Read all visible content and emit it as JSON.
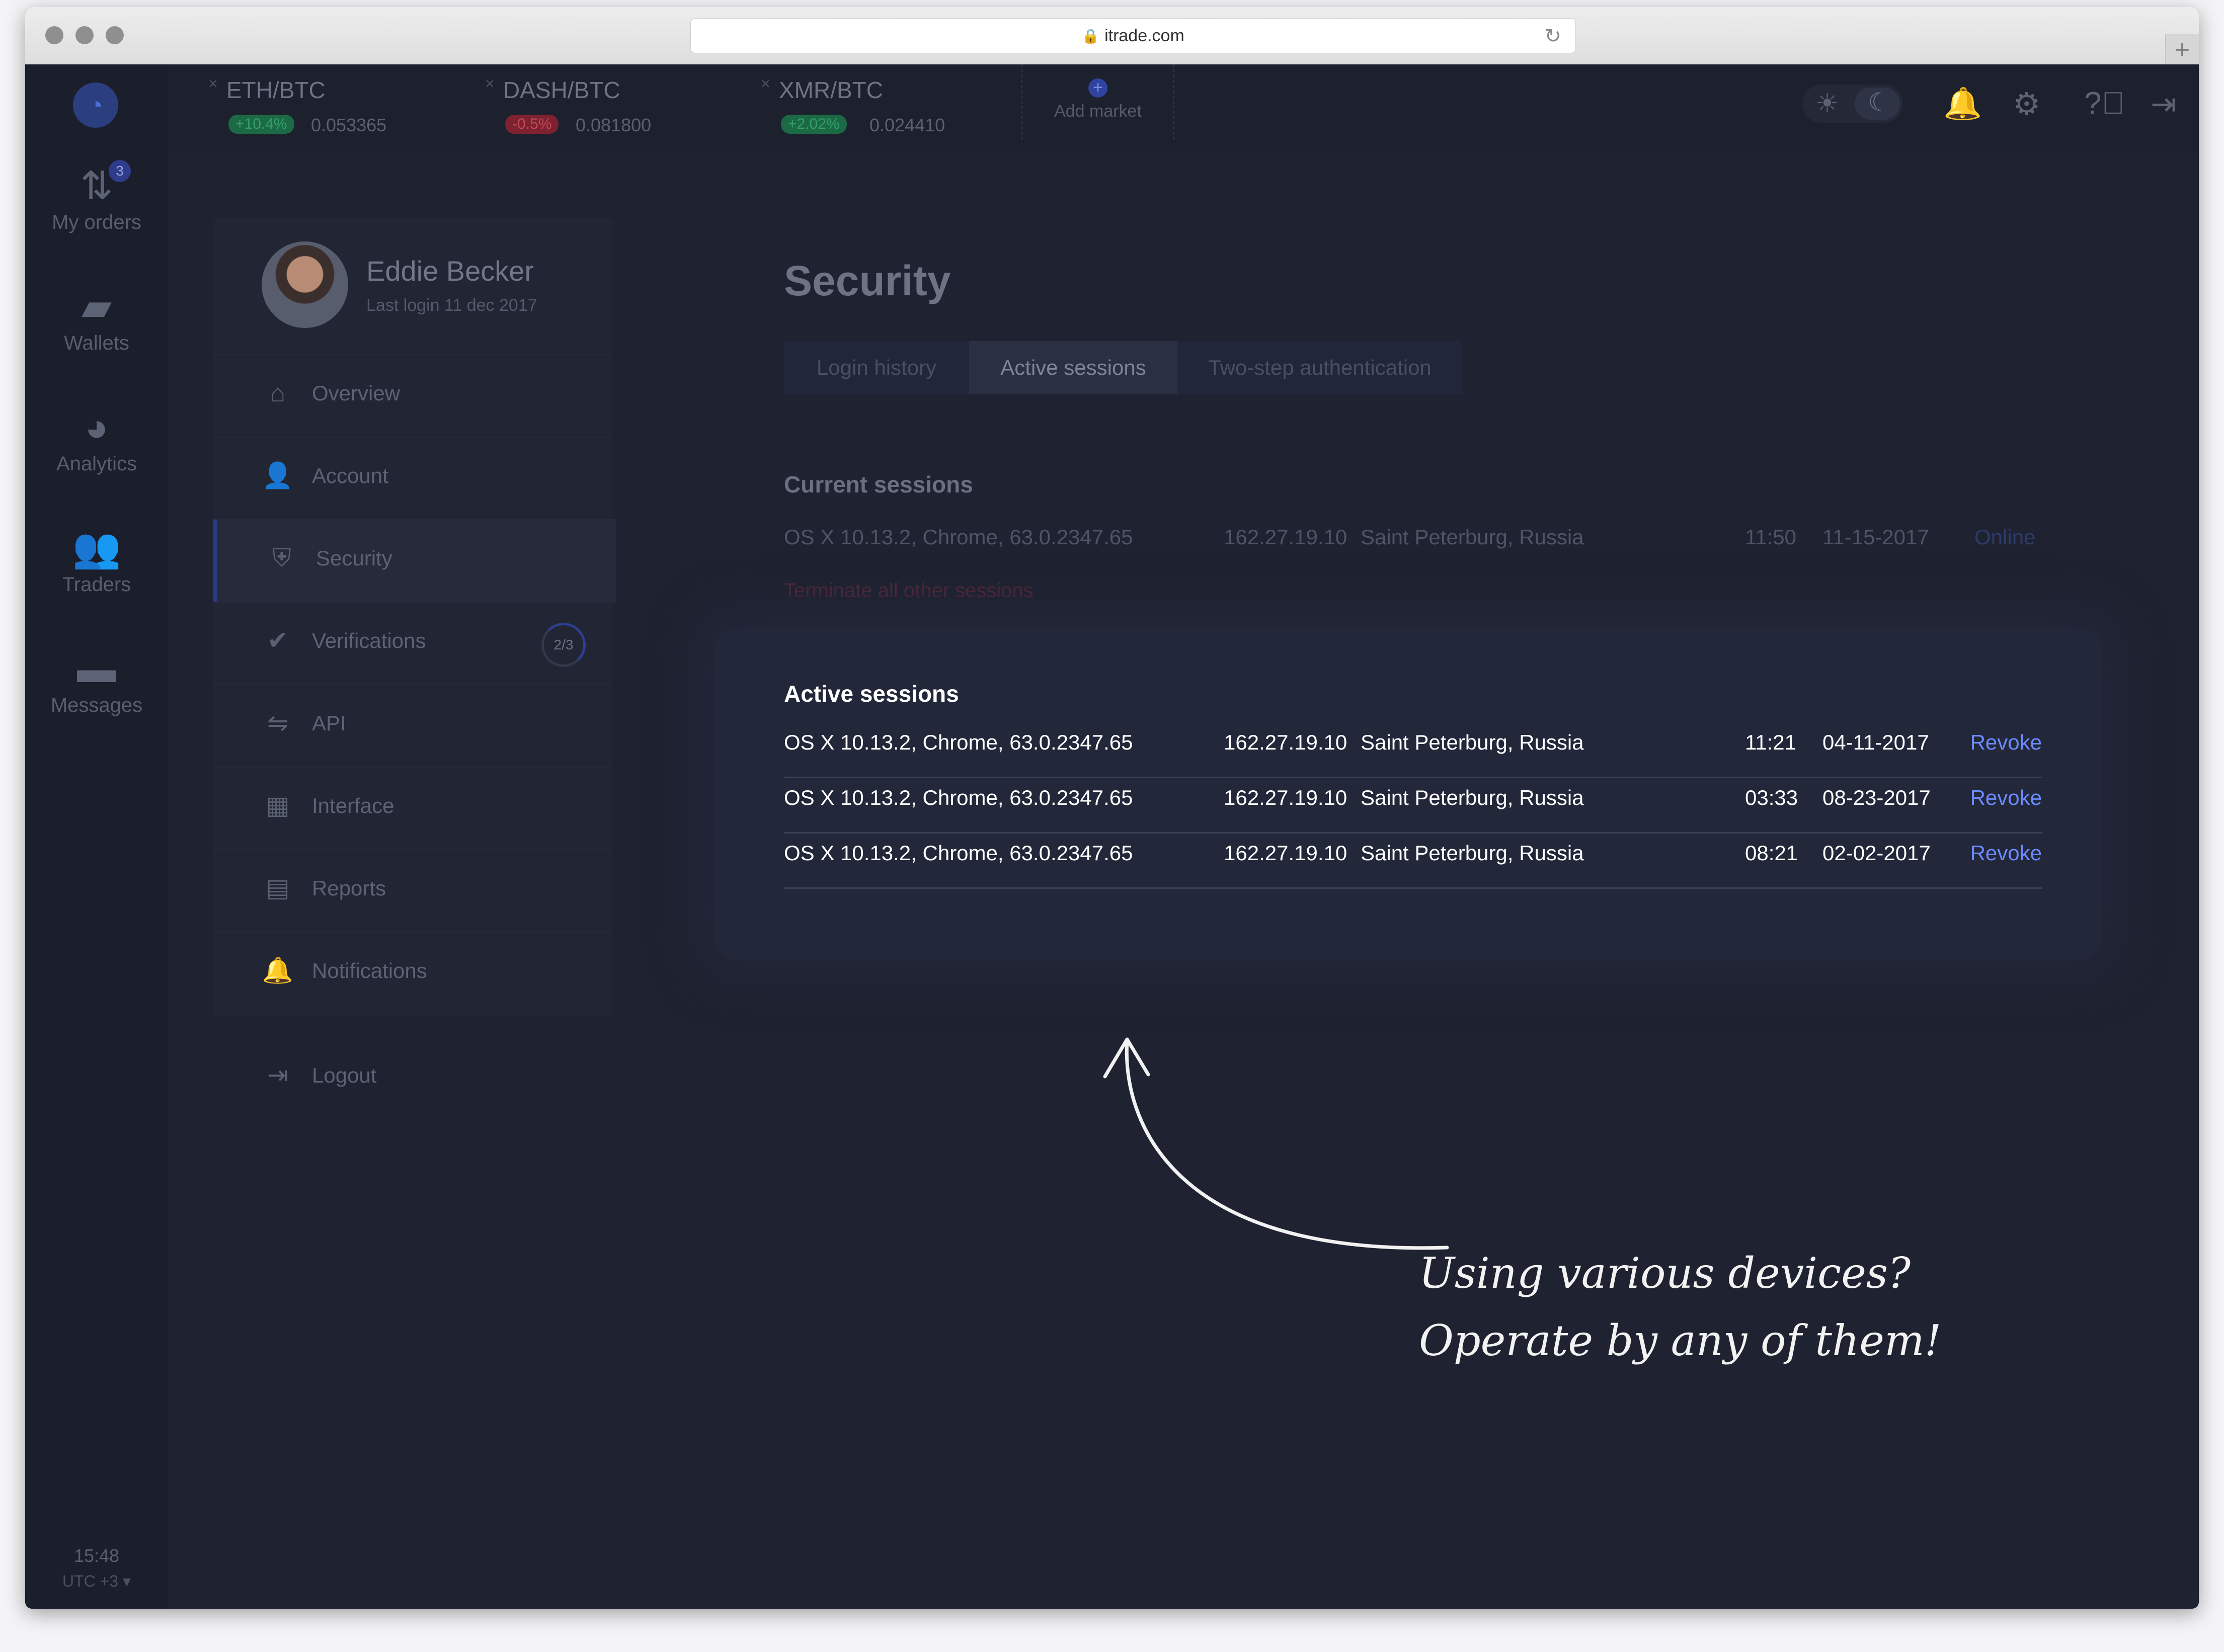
{
  "browser": {
    "url": "itrade.com"
  },
  "rail": {
    "orders_badge": "3",
    "items": [
      {
        "label": "My orders",
        "icon": "arrows-updown-icon"
      },
      {
        "label": "Wallets",
        "icon": "wallet-icon"
      },
      {
        "label": "Analytics",
        "icon": "pie-chart-icon"
      },
      {
        "label": "Traders",
        "icon": "users-icon"
      },
      {
        "label": "Messages",
        "icon": "chat-icon"
      }
    ],
    "clock": "15:48",
    "timezone": "UTC +3 ▾"
  },
  "markets": [
    {
      "pair": "ETH/BTC",
      "change": "+10.4%",
      "price": "0.053365",
      "direction": "up"
    },
    {
      "pair": "DASH/BTC",
      "change": "-0.5%",
      "price": "0.081800",
      "direction": "down"
    },
    {
      "pair": "XMR/BTC",
      "change": "+2.02%",
      "price": "0.024410",
      "direction": "up"
    }
  ],
  "add_market": "Add market",
  "profile": {
    "name": "Eddie Becker",
    "last_login": "Last login 11 dec 2017",
    "menu": [
      {
        "label": "Overview",
        "icon": "home-icon"
      },
      {
        "label": "Account",
        "icon": "person-icon"
      },
      {
        "label": "Security",
        "icon": "shield-icon",
        "active": true
      },
      {
        "label": "Verifications",
        "icon": "check-circle-icon",
        "progress": "2/3"
      },
      {
        "label": "API",
        "icon": "api-icon"
      },
      {
        "label": "Interface",
        "icon": "table-icon"
      },
      {
        "label": "Reports",
        "icon": "document-icon"
      },
      {
        "label": "Notifications",
        "icon": "bell-icon"
      }
    ],
    "logout": "Logout"
  },
  "page": {
    "title": "Security",
    "tabs": [
      {
        "label": "Login history"
      },
      {
        "label": "Active sessions",
        "active": true
      },
      {
        "label": "Two-step authentication"
      }
    ]
  },
  "current_sessions": {
    "title": "Current sessions",
    "row": {
      "device": "OS X 10.13.2, Chrome, 63.0.2347.65",
      "ip": "162.27.19.10",
      "location": "Saint Peterburg, Russia",
      "time": "11:50",
      "date": "11-15-2017",
      "status": "Online"
    },
    "terminate": "Terminate all other sessions"
  },
  "active_sessions": {
    "title": "Active sessions",
    "rows": [
      {
        "device": "OS X 10.13.2, Chrome, 63.0.2347.65",
        "ip": "162.27.19.10",
        "location": "Saint Peterburg, Russia",
        "time": "11:21",
        "date": "04-11-2017",
        "action": "Revoke"
      },
      {
        "device": "OS X 10.13.2, Chrome, 63.0.2347.65",
        "ip": "162.27.19.10",
        "location": "Saint Peterburg, Russia",
        "time": "03:33",
        "date": "08-23-2017",
        "action": "Revoke"
      },
      {
        "device": "OS X 10.13.2, Chrome, 63.0.2347.65",
        "ip": "162.27.19.10",
        "location": "Saint Peterburg, Russia",
        "time": "08:21",
        "date": "02-02-2017",
        "action": "Revoke"
      }
    ]
  },
  "annotation": {
    "line1": "Using various devices?",
    "line2": "Operate by any of them!"
  },
  "colors": {
    "background": "#1f2230",
    "accent": "#6b8bff",
    "positive": "#33a06a",
    "negative": "#c14857"
  }
}
